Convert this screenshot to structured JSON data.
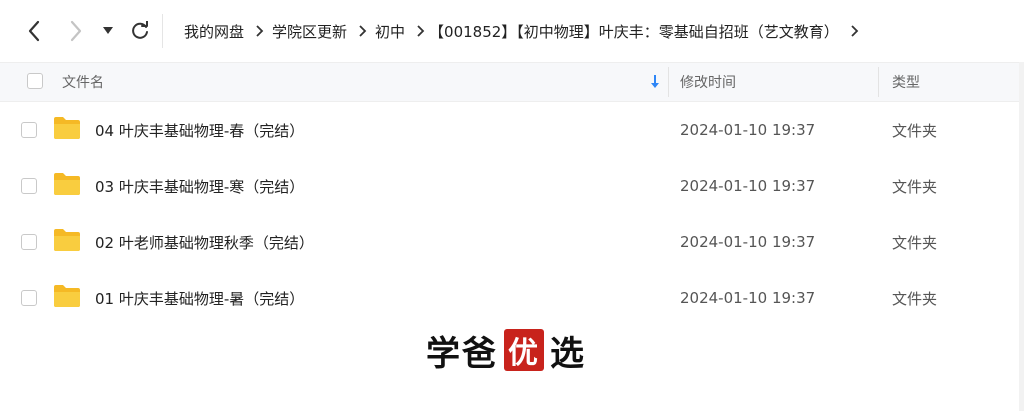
{
  "toolbar": {
    "breadcrumbs": [
      "我的网盘",
      "学院区更新",
      "初中",
      "【001852】【初中物理】叶庆丰：零基础自招班（艺文教育）"
    ]
  },
  "table": {
    "headers": {
      "name": "文件名",
      "modified": "修改时间",
      "type": "类型"
    },
    "rows": [
      {
        "name": "04 叶庆丰基础物理-春（完结）",
        "modified": "2024-01-10 19:37",
        "type": "文件夹"
      },
      {
        "name": "03 叶庆丰基础物理-寒（完结）",
        "modified": "2024-01-10 19:37",
        "type": "文件夹"
      },
      {
        "name": "02 叶老师基础物理秋季（完结）",
        "modified": "2024-01-10 19:37",
        "type": "文件夹"
      },
      {
        "name": "01 叶庆丰基础物理-暑（完结）",
        "modified": "2024-01-10 19:37",
        "type": "文件夹"
      }
    ]
  },
  "watermark": {
    "part1": "学爸",
    "seal": "优",
    "part2": "选"
  },
  "colors": {
    "folder": "#f7c531",
    "sort_arrow": "#2f86f6",
    "seal": "#c8231c"
  }
}
